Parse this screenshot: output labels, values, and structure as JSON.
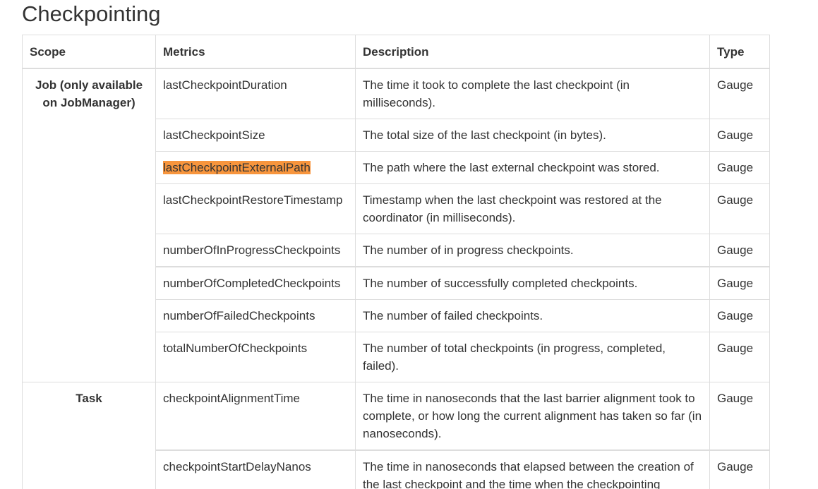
{
  "page": {
    "title": "Checkpointing"
  },
  "table": {
    "headers": {
      "scope": "Scope",
      "metrics": "Metrics",
      "description": "Description",
      "type": "Type"
    },
    "groups": [
      {
        "scope": "Job (only available on JobManager)",
        "rows": [
          {
            "metric": "lastCheckpointDuration",
            "description": "The time it took to complete the last checkpoint (in milliseconds).",
            "type": "Gauge"
          },
          {
            "metric": "lastCheckpointSize",
            "description": "The total size of the last checkpoint (in bytes).",
            "type": "Gauge"
          },
          {
            "metric": "lastCheckpointExternalPath",
            "description": "The path where the last external checkpoint was stored.",
            "type": "Gauge",
            "highlighted": true
          },
          {
            "metric": "lastCheckpointRestoreTimestamp",
            "description": "Timestamp when the last checkpoint was restored at the coordinator (in milliseconds).",
            "type": "Gauge"
          },
          {
            "metric": "numberOfInProgressCheckpoints",
            "description": "The number of in progress checkpoints.",
            "type": "Gauge"
          },
          {
            "metric": "numberOfCompletedCheckpoints",
            "description": "The number of successfully completed checkpoints.",
            "type": "Gauge"
          },
          {
            "metric": "numberOfFailedCheckpoints",
            "description": "The number of failed checkpoints.",
            "type": "Gauge"
          },
          {
            "metric": "totalNumberOfCheckpoints",
            "description": "The number of total checkpoints (in progress, completed, failed).",
            "type": "Gauge"
          }
        ]
      },
      {
        "scope": "Task",
        "rows": [
          {
            "metric": "checkpointAlignmentTime",
            "description": "The time in nanoseconds that the last barrier alignment took to complete, or how long the current alignment has taken so far (in nanoseconds).",
            "type": "Gauge"
          },
          {
            "metric": "checkpointStartDelayNanos",
            "description": "The time in nanoseconds that elapsed between the creation of the last checkpoint and the time when the checkpointing",
            "type": "Gauge"
          }
        ]
      }
    ]
  },
  "colors": {
    "highlight": "#f7953d",
    "border": "#dddddd",
    "text": "#333333"
  }
}
